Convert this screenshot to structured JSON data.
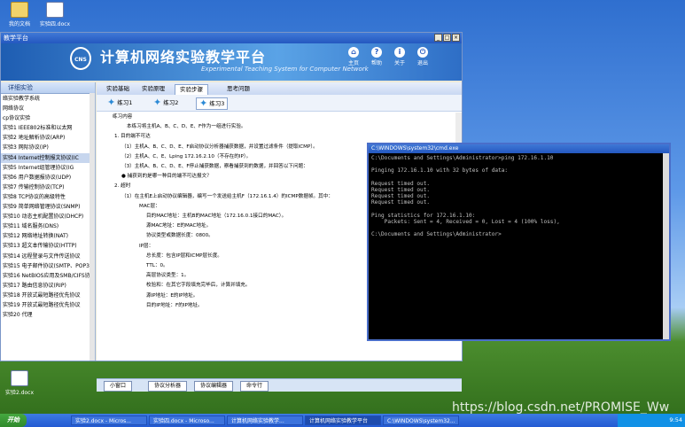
{
  "desktop": {
    "icons": [
      {
        "label": "我的文档"
      },
      {
        "label": "实验四.docx"
      },
      {
        "label": "实验2.docx"
      }
    ]
  },
  "window": {
    "title": "教学平台",
    "app_title": "计算机网络实验教学平台",
    "app_subtitle": "Experimental Teaching System for Computer Network",
    "logo_text": "CNS",
    "toolbar": [
      "主页",
      "帮助",
      "关于",
      "退出"
    ]
  },
  "sidebar": {
    "header": "详细实验",
    "items": [
      {
        "label": "络实验教学系统"
      },
      {
        "label": "网络协议"
      },
      {
        "label": "cp协议实验"
      },
      {
        "label": "实验1 IEEE802标准和以太网"
      },
      {
        "label": "实验2 地址解析协议(ARP)"
      },
      {
        "label": "实验3 网际协议(IP)"
      },
      {
        "label": "实验4 Internet控制报文协议(IC"
      },
      {
        "label": "实验5 Internet组管理协议(IG"
      },
      {
        "label": "实验6 用户数据报协议(UDP)"
      },
      {
        "label": "实验7 传输控制协议(TCP)"
      },
      {
        "label": "实验8 TCP协议的高级特性"
      },
      {
        "label": "实验9 简单网络管理协议(SNMP)"
      },
      {
        "label": "实验10 动态主机配置协议(DHCP)"
      },
      {
        "label": "实验11 域名服务(DNS)"
      },
      {
        "label": "实验12 网络地址转换(NAT)"
      },
      {
        "label": "实验13 超文本传输协议(HTTP)"
      },
      {
        "label": "实验14 远程登录与文件传送协议"
      },
      {
        "label": "实验15 电子邮件协议(SMTP、POP3"
      },
      {
        "label": "实验16 NetBIOS应用及SMB/CIFS协"
      },
      {
        "label": "实验17 路由信息协议(RIP)"
      },
      {
        "label": "实验18 开放式最短路径优先协议"
      },
      {
        "label": "实验19 开放式最短路径优先协议"
      },
      {
        "label": "实验20 代理"
      }
    ],
    "selected_index": 6
  },
  "tabs": [
    "实验基础",
    "实验原理",
    "实验步骤",
    "思考问题"
  ],
  "active_tab_index": 2,
  "exercises": [
    "练习1",
    "练习2",
    "练习3"
  ],
  "active_exercise_index": 2,
  "document_lines": [
    "练习内容",
    "本练习将主机A、B、C、D、E、F作为一组进行实验。",
    "1.  目的端不可达",
    "（1）主机A、B、C、D、E、F启动协议分析器捕获数据，并设置过滤条件（提取ICMP）。",
    "（2）主机A、C、E、Lping 172.16.2.10（不存在的IP）。",
    "（3）主机A、B、C、D、E、F停止捕获数据，察看捕获到的数据，并回答以下问题：",
    "●  捕获到的是哪一种目的端不可达报文？",
    "2.  超时",
    "（1）在主机E上启动协议编辑器，编写一个发送给主机F（172.16.1.4）的ICMP数据帧。其中：",
    "MAC层：",
    "目的MAC地址：主机B的MAC地址（172.16.0.1接口的MAC）。",
    "源MAC地址：E的MAC地址。",
    "协议类型或数据长度：0800。",
    "IP层：",
    "总长度：包含IP层和ICMP层长度。",
    "TTL：0。",
    "高层协议类型：1。",
    "校验和：在其它字段填充完毕后，计算并填充。",
    "源IP地址：E的IP地址。",
    "目的IP地址：F的IP地址。"
  ],
  "bottom_buttons": [
    "小窗口",
    "协议分析器",
    "协议编辑器",
    "命令行"
  ],
  "cmd": {
    "title": "C:\\WINDOWS\\system32\\cmd.exe",
    "lines": [
      "C:\\Documents and Settings\\Administrator>ping 172.16.1.10",
      "",
      "Pinging 172.16.1.10 with 32 bytes of data:",
      "",
      "Request timed out.",
      "Request timed out.",
      "Request timed out.",
      "Request timed out.",
      "",
      "Ping statistics for 172.16.1.10:",
      "    Packets: Sent = 4, Received = 0, Lost = 4 (100% loss),",
      "",
      "C:\\Documents and Settings\\Administrator>"
    ]
  },
  "taskbar": {
    "start_label": "开始",
    "tasks": [
      {
        "label": "实验2.docx - Micros..."
      },
      {
        "label": "实验四.docx - Microso..."
      },
      {
        "label": "计算机网络实验教学..."
      },
      {
        "label": "计算机网络实验教学平台"
      },
      {
        "label": "C:\\WINDOWS\\system32..."
      }
    ],
    "clock": "9:54"
  },
  "watermark": "https://blog.csdn.net/PROMISE_Ww"
}
